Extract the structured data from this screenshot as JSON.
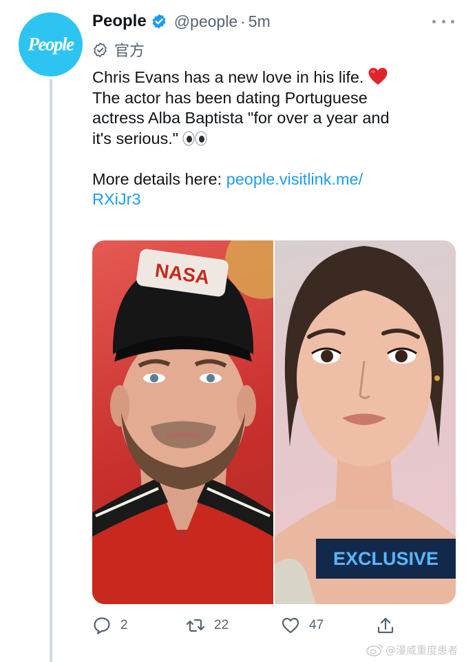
{
  "account": {
    "avatar_text": "People",
    "name": "People",
    "handle": "@people",
    "separator": "·",
    "time": "5m",
    "official_label": "官方"
  },
  "tweet": {
    "line1": "Chris Evans has a new love in his life.",
    "line2": "The actor has been dating Portuguese",
    "line3": "actress Alba Baptista \"for over a year and",
    "line4": "it's serious.\"",
    "details_prefix": "More details here: ",
    "link_part1": "people.visitlink.me/",
    "link_part2": "RXiJr3"
  },
  "media": {
    "badge_text": "EXCLUSIVE",
    "cap_logo_text": "NASA"
  },
  "actions": {
    "reply_count": "2",
    "retweet_count": "22",
    "like_count": "47"
  },
  "watermark": {
    "text": "@漫威重度患者"
  },
  "colors": {
    "avatar_bg": "#2ec4f1",
    "link": "#1d9bf0",
    "badge_bg": "#13294b",
    "badge_text": "#57b8ff",
    "secondary_text": "#536471"
  }
}
